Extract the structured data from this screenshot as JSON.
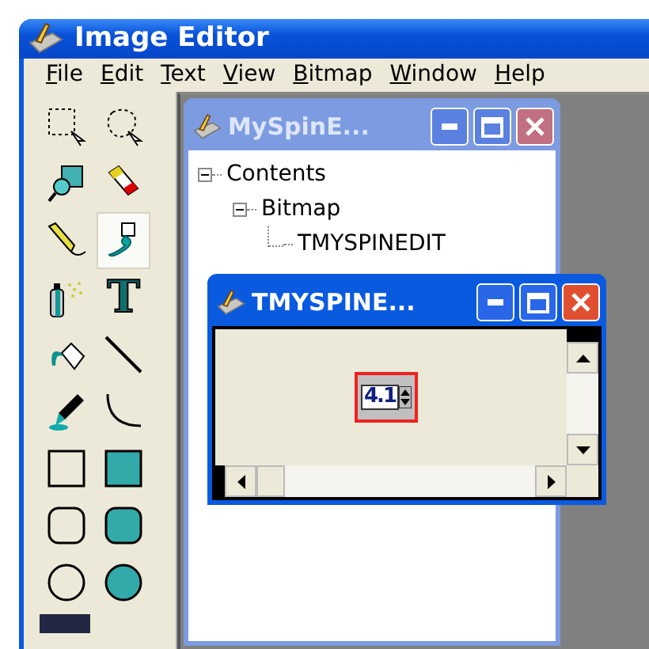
{
  "window": {
    "title": "Image Editor"
  },
  "menu": [
    {
      "label": "File"
    },
    {
      "label": "Edit"
    },
    {
      "label": "Text"
    },
    {
      "label": "View"
    },
    {
      "label": "Bitmap"
    },
    {
      "label": "Window"
    },
    {
      "label": "Help"
    }
  ],
  "tools": [
    {
      "kind": "select-rect",
      "selected": false
    },
    {
      "kind": "lasso",
      "selected": false
    },
    {
      "kind": "zoom",
      "selected": false
    },
    {
      "kind": "eraser",
      "selected": false
    },
    {
      "kind": "pencil",
      "selected": false
    },
    {
      "kind": "brush",
      "selected": true
    },
    {
      "kind": "spray",
      "selected": false
    },
    {
      "kind": "text",
      "selected": false,
      "glyph": "T"
    },
    {
      "kind": "fill",
      "selected": false
    },
    {
      "kind": "line",
      "selected": false
    },
    {
      "kind": "picker",
      "selected": false
    },
    {
      "kind": "curve",
      "selected": false
    },
    {
      "kind": "rect",
      "selected": false
    },
    {
      "kind": "rect-filled",
      "selected": false
    },
    {
      "kind": "rounded",
      "selected": false
    },
    {
      "kind": "rounded-filled",
      "selected": false
    },
    {
      "kind": "ellipse",
      "selected": false
    },
    {
      "kind": "ellipse-filled",
      "selected": false
    }
  ],
  "tree_window": {
    "title": "MySpinE...",
    "active": false,
    "tree": [
      {
        "label": "Contents",
        "expanded": true,
        "children": [
          {
            "label": "Bitmap",
            "expanded": true,
            "children": [
              {
                "label": "TMYSPINEDIT"
              }
            ]
          }
        ]
      }
    ]
  },
  "bitmap_window": {
    "title": "TMYSPINE...",
    "active": true,
    "spin_value": "4.1"
  }
}
